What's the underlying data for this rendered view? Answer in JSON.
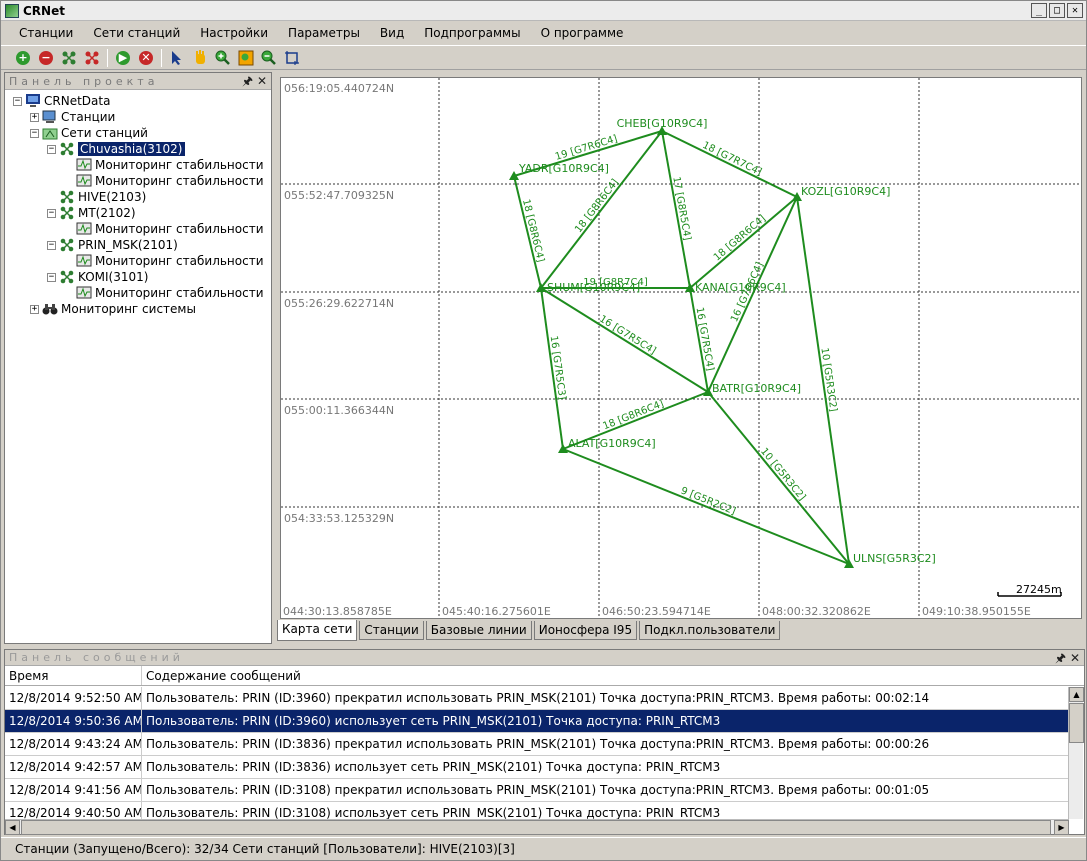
{
  "app": {
    "title": "CRNet"
  },
  "window_buttons": {
    "minimize": "_",
    "maximize": "□",
    "close": "✕"
  },
  "menu": [
    "Станции",
    "Сети станций",
    "Настройки",
    "Параметры",
    "Вид",
    "Подпрограммы",
    "О программе"
  ],
  "toolbar_icons": [
    "add-icon",
    "remove-icon",
    "network-add-icon",
    "network-remove-icon",
    "play-icon",
    "stop-icon",
    "pointer-icon",
    "hand-icon",
    "zoom-in-icon",
    "zoom-extent-icon",
    "zoom-out-icon",
    "zoom-window-icon"
  ],
  "project_panel": {
    "title": "Панель проекта",
    "pin": "🖈",
    "close": "✕",
    "tree": [
      {
        "label": "CRNetData",
        "level": 0,
        "icon": "computer-icon",
        "expand": "−"
      },
      {
        "label": "Станции",
        "level": 1,
        "icon": "stations-icon",
        "expand": "+"
      },
      {
        "label": "Сети станций",
        "level": 1,
        "icon": "networks-folder-icon",
        "expand": "−"
      },
      {
        "label": "Chuvashia(3102)",
        "level": 2,
        "icon": "network-icon",
        "expand": "−",
        "selected": true
      },
      {
        "label": "Мониторинг стабильности",
        "level": 3,
        "icon": "monitor-icon"
      },
      {
        "label": "Мониторинг стабильности",
        "level": 3,
        "icon": "monitor-icon"
      },
      {
        "label": "HIVE(2103)",
        "level": 2,
        "icon": "network-icon"
      },
      {
        "label": "MT(2102)",
        "level": 2,
        "icon": "network-icon",
        "expand": "−"
      },
      {
        "label": "Мониторинг стабильности",
        "level": 3,
        "icon": "monitor-icon"
      },
      {
        "label": "PRIN_MSK(2101)",
        "level": 2,
        "icon": "network-icon",
        "expand": "−"
      },
      {
        "label": "Мониторинг стабильности",
        "level": 3,
        "icon": "monitor-icon"
      },
      {
        "label": "KOMI(3101)",
        "level": 2,
        "icon": "network-icon",
        "expand": "−"
      },
      {
        "label": "Мониторинг стабильности",
        "level": 3,
        "icon": "monitor-icon"
      },
      {
        "label": "Мониторинг системы",
        "level": 1,
        "icon": "binoculars-icon",
        "expand": "+"
      }
    ]
  },
  "map": {
    "lat_labels": [
      "056:19:05.440724N",
      "055:52:47.709325N",
      "055:26:29.622714N",
      "055:00:11.366344N",
      "054:33:53.125329N"
    ],
    "lon_labels": [
      "044:30:13.858785E",
      "045:40:16.275601E",
      "046:50:23.594714E",
      "048:00:32.320862E",
      "049:10:38.950155E"
    ],
    "scale_label": "27245m",
    "line_color": "#1e8c1e",
    "stations": [
      {
        "id": "CHEB",
        "label": "CHEB[G10R9C4]"
      },
      {
        "id": "YADR",
        "label": "YADR[G10R9C4]"
      },
      {
        "id": "KOZL",
        "label": "KOZL[G10R9C4]"
      },
      {
        "id": "SHUM",
        "label": "SHUM[G10R9C4]"
      },
      {
        "id": "KANA",
        "label": "KANA[G10R9C4]"
      },
      {
        "id": "BATR",
        "label": "BATR[G10R9C4]"
      },
      {
        "id": "ALAT",
        "label": "ALAT[G10R9C4]"
      },
      {
        "id": "ULNS",
        "label": "ULNS[G5R3C2]"
      }
    ],
    "baselines": [
      {
        "from": "YADR",
        "to": "CHEB",
        "label": "19 [G7R6C4]"
      },
      {
        "from": "CHEB",
        "to": "SHUM",
        "label": "18 [G8R6C4]"
      },
      {
        "from": "CHEB",
        "to": "KANA",
        "label": "17 [G8R5C4]"
      },
      {
        "from": "CHEB",
        "to": "KOZL",
        "label": "18 [G7R7C4]"
      },
      {
        "from": "YADR",
        "to": "SHUM",
        "label": "18 [G8R6C4]"
      },
      {
        "from": "SHUM",
        "to": "KANA",
        "label": "19 [G8R7C4]"
      },
      {
        "from": "KANA",
        "to": "KOZL",
        "label": "18 [G8R6C4]"
      },
      {
        "from": "KOZL",
        "to": "BATR",
        "label": "16 [G7R6C4]"
      },
      {
        "from": "SHUM",
        "to": "BATR",
        "label": "16 [G7R5C4]"
      },
      {
        "from": "SHUM",
        "to": "ALAT",
        "label": "16 [G7R5C3]"
      },
      {
        "from": "KANA",
        "to": "BATR",
        "label": "16 [G7R5C4]"
      },
      {
        "from": "ALAT",
        "to": "BATR",
        "label": "18 [G8R6C4]"
      },
      {
        "from": "KOZL",
        "to": "ULNS",
        "label": "10 [G5R3C2]"
      },
      {
        "from": "BATR",
        "to": "ULNS",
        "label": "10 [G5R3C2]"
      },
      {
        "from": "ALAT",
        "to": "ULNS",
        "label": "9 [G5R2C2]"
      }
    ]
  },
  "map_tabs": [
    "Карта сети",
    "Станции",
    "Базовые линии",
    "Ионосфера I95",
    "Подкл.пользователи"
  ],
  "message_panel": {
    "title": "Панель сообщений",
    "pin": "🖈",
    "close": "✕",
    "columns": [
      "Время",
      "Содержание сообщений"
    ],
    "rows": [
      {
        "time": "12/8/2014 9:52:50 AM",
        "text": "Пользователь: PRIN  (ID:3960) прекратил использовать PRIN_MSK(2101) Точка доступа:PRIN_RTCM3.  Время работы: 00:02:14"
      },
      {
        "time": "12/8/2014 9:50:36 AM",
        "text": "Пользователь: PRIN  (ID:3960) использует сеть PRIN_MSK(2101) Точка доступа: PRIN_RTCM3",
        "selected": true
      },
      {
        "time": "12/8/2014 9:43:24 AM",
        "text": "Пользователь: PRIN  (ID:3836) прекратил использовать PRIN_MSK(2101) Точка доступа:PRIN_RTCM3.  Время работы: 00:00:26"
      },
      {
        "time": "12/8/2014 9:42:57 AM",
        "text": "Пользователь: PRIN  (ID:3836) использует сеть PRIN_MSK(2101) Точка доступа: PRIN_RTCM3"
      },
      {
        "time": "12/8/2014 9:41:56 AM",
        "text": "Пользователь: PRIN  (ID:3108) прекратил использовать PRIN_MSK(2101) Точка доступа:PRIN_RTCM3.  Время работы: 00:01:05"
      },
      {
        "time": "12/8/2014 9:40:50 AM",
        "text": "Пользователь: PRIN  (ID:3108) использует сеть PRIN_MSK(2101) Точка доступа: PRIN_RTCM3"
      }
    ]
  },
  "statusbar": {
    "text": "Станции (Запущено/Всего): 32/34  Сети станций [Пользователи]: HIVE(2103)[3]"
  }
}
